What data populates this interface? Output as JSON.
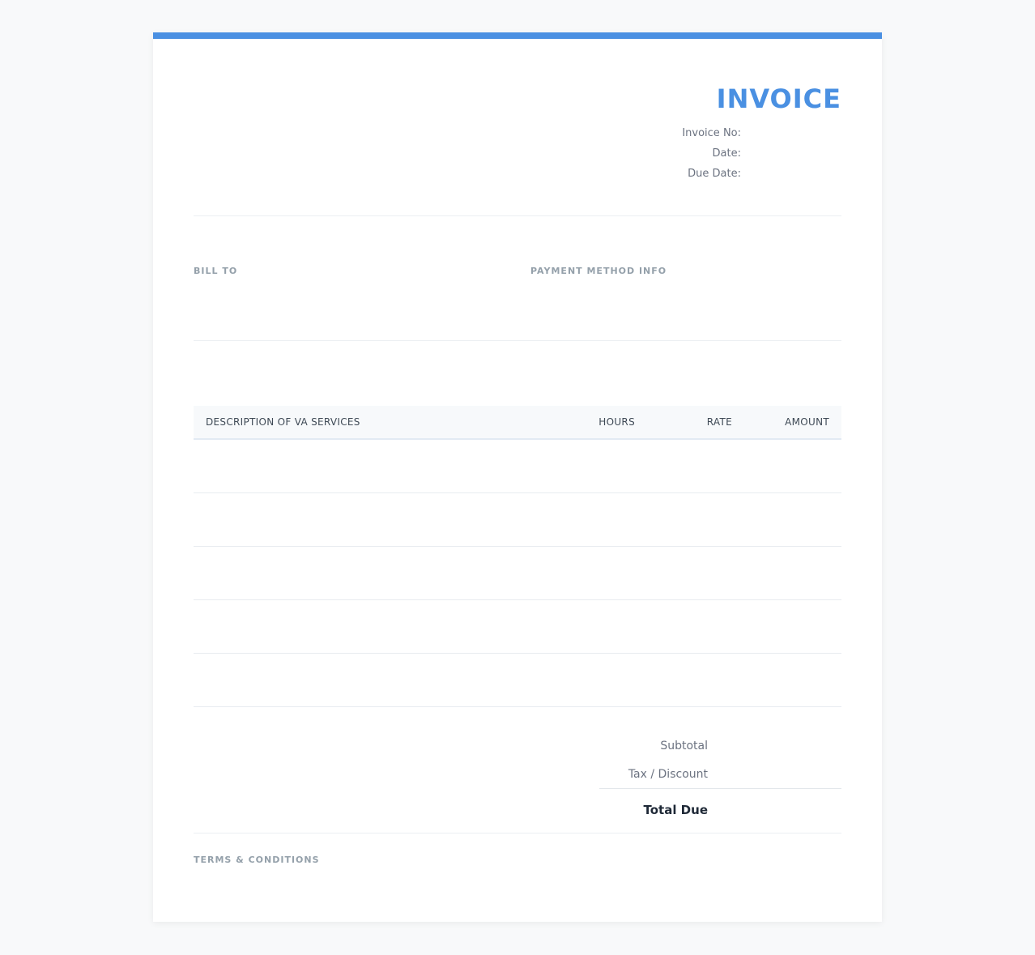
{
  "colors": {
    "accent": "#4a90e2",
    "background": "#f8f9fa",
    "label": "#94a0aa"
  },
  "header": {
    "title": "INVOICE",
    "invoice_no_label": "Invoice No:",
    "date_label": "Date:",
    "due_date_label": "Due Date:"
  },
  "sections": {
    "bill_to": "BILL TO",
    "payment_method": "PAYMENT METHOD INFO"
  },
  "table": {
    "columns": [
      "DESCRIPTION OF VA SERVICES",
      "HOURS",
      "RATE",
      "AMOUNT"
    ]
  },
  "totals": {
    "subtotal_label": "Subtotal",
    "tax_label": "Tax / Discount",
    "total_label": "Total Due"
  },
  "footer": {
    "terms_label": "TERMS & CONDITIONS"
  }
}
